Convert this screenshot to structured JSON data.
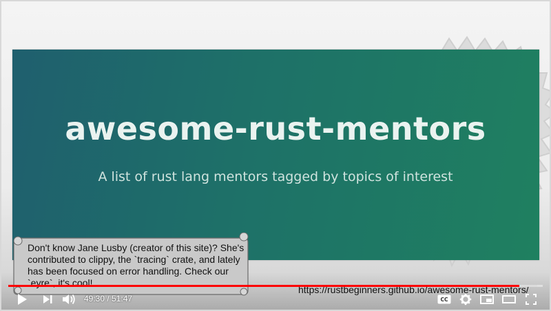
{
  "video": {
    "banner_title": "awesome-rust-mentors",
    "banner_subtitle": "A list of rust lang mentors tagged by topics of interest",
    "url_text": "https://rustbeginners.github.io/awesome-rust-mentors/",
    "annotation": "Don't know Jane Lusby (creator of this site)? She's contributed to clippy, the `tracing` crate, and lately has been focused on error handling. Check our `eyre`, it's cool!"
  },
  "player": {
    "current_time": "49:30",
    "separator": " / ",
    "duration": "51:47",
    "progress_played": 0.956,
    "progress_loaded": 0.99,
    "accent_color": "#ff0000",
    "icons": [
      "play-icon",
      "next-icon",
      "volume-icon",
      "captions-icon",
      "settings-icon",
      "miniplayer-icon",
      "theater-icon",
      "fullscreen-icon"
    ]
  }
}
